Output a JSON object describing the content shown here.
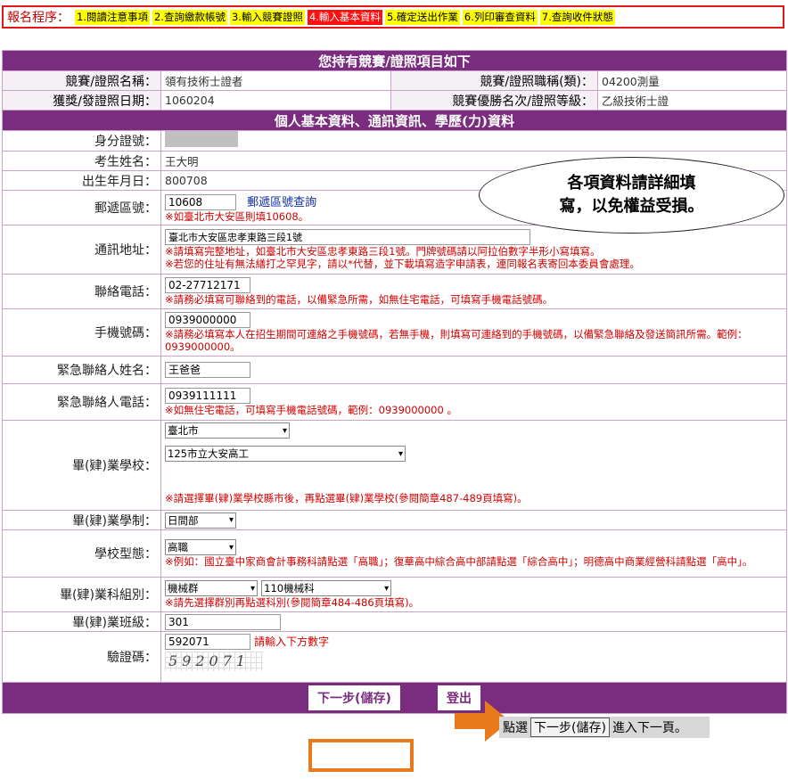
{
  "steps": {
    "label": "報名程序：",
    "items": [
      {
        "label": "1.閱讀注意事項",
        "active": false
      },
      {
        "label": "2.查詢繳款帳號",
        "active": false
      },
      {
        "label": "3.輸入競賽證照",
        "active": false
      },
      {
        "label": "4.輸入基本資料",
        "active": true
      },
      {
        "label": "5.確定送出作業",
        "active": false
      },
      {
        "label": "6.列印審查資料",
        "active": false
      },
      {
        "label": "7.查詢收件狀態",
        "active": false
      }
    ]
  },
  "cert": {
    "header": "您持有競賽/證照項目如下",
    "name_label": "競賽/證照名稱：",
    "name_value": "領有技術士證者",
    "title_label": "競賽/證照職稱(類)：",
    "title_value": "04200測量",
    "date_label": "獲獎/發證照日期：",
    "date_value": "1060204",
    "rank_label": "競賽優勝名次/證照等級：",
    "rank_value": "乙級技術士證"
  },
  "personal": {
    "header": "個人基本資料、通訊資訊、學歷(力)資料",
    "id_label": "身分證號：",
    "name_label": "考生姓名：",
    "name_value": "王大明",
    "birth_label": "出生年月日：",
    "birth_value": "800708",
    "zip_label": "郵遞區號：",
    "zip_value": "10608",
    "zip_link": "郵遞區號查詢",
    "zip_note": "※如臺北市大安區則填10608。",
    "addr_label": "通訊地址：",
    "addr_value": "臺北市大安區忠孝東路三段1號",
    "addr_note1": "※請填寫完整地址，如臺北市大安區忠孝東路三段1號。門牌號碼請以阿拉伯數字半形小寫填寫。",
    "addr_note2": "※若您的住址有無法繕打之罕見字，請以*代替，並下載填寫造字申請表，連同報名表寄回本委員會處理。",
    "phone_label": "聯絡電話：",
    "phone_value": "02-27712171",
    "phone_note": "※請務必填寫可聯絡到的電話，以備緊急所需，如無住宅電話，可填寫手機電話號碼。",
    "mobile_label": "手機號碼：",
    "mobile_value": "0939000000",
    "mobile_note": "※請務必填寫本人在招生期間可連絡之手機號碼，若無手機，則填寫可連絡到的手機號碼，以備緊急聯絡及發送簡訊所需。範例：0939000000。",
    "emg_name_label": "緊急聯絡人姓名：",
    "emg_name_value": "王爸爸",
    "emg_phone_label": "緊急聯絡人電話：",
    "emg_phone_value": "0939111111",
    "emg_phone_note": "※如無住宅電話，可填寫手機電話號碼，範例：0939000000 。",
    "school_label": "畢(肄)業學校：",
    "school_city": "臺北市",
    "school_value": "125市立大安高工",
    "school_note": "※請選擇畢(肄)業學校縣市後，再點選畢(肄)業學校(參閱簡章487-489頁填寫)。",
    "system_label": "畢(肄)業學制：",
    "system_value": "日間部",
    "type_label": "學校型態：",
    "type_value": "高職",
    "type_note": "※例如：國立臺中家商會計事務科請點選「高職」；復華高中綜合高中部請點選「綜合高中」；明德高中商業經營科請點選「高中」。",
    "group_label": "畢(肄)業科組別：",
    "group_value": "機械群",
    "dept_value": "110機械科",
    "group_note": "※請先選擇群別再點選科別(參閱簡章484-486頁填寫)。",
    "class_label": "畢(肄)業班級：",
    "class_value": "301",
    "captcha_label": "驗證碼：",
    "captcha_value": "592071",
    "captcha_note": "請輸入下方數字",
    "captcha_image_text": "592071"
  },
  "buttons": {
    "next": "下一步(儲存)",
    "logout": "登出"
  },
  "callout": {
    "line1": "各項資料請詳細填",
    "line2": "寫，以免權益受損。"
  },
  "hint": {
    "pre": "點選",
    "button": "下一步(儲存)",
    "post": "進入下一頁。"
  },
  "colors": {
    "header_bg": "#7a2c7f",
    "note_red": "#d00000",
    "active_step": "#ff1010",
    "step_bg": "#ffff00",
    "highlight_orange": "#e87a1c"
  }
}
